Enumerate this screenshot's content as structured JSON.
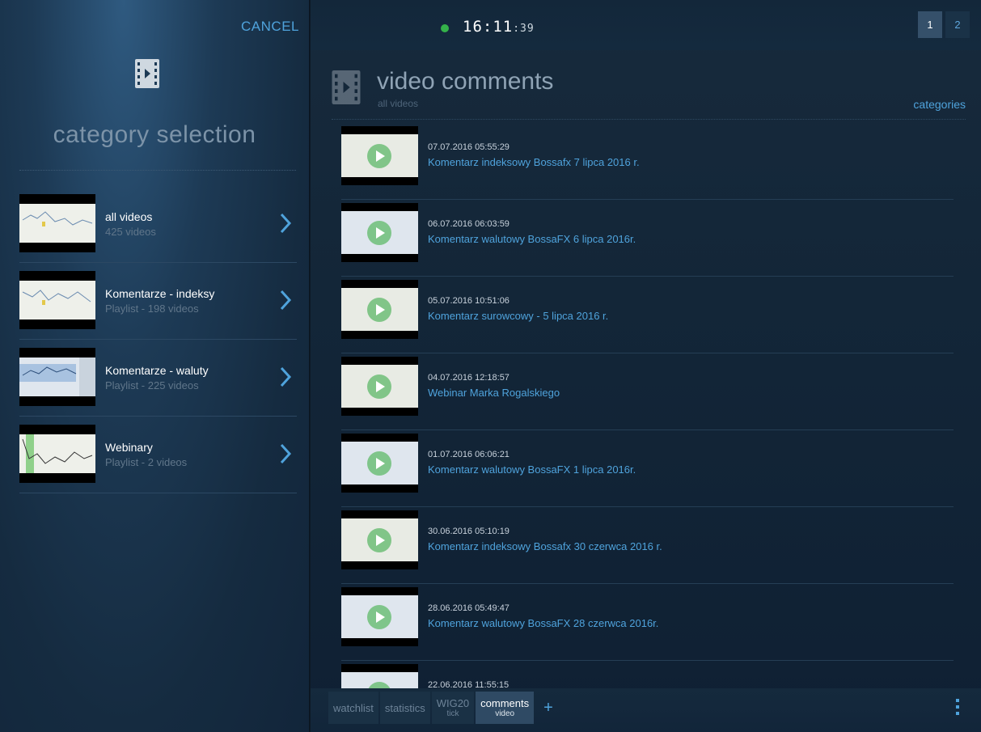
{
  "left_panel": {
    "cancel_label": "CANCEL",
    "title": "category selection",
    "categories": [
      {
        "name": "all videos",
        "sub": "425 videos"
      },
      {
        "name": "Komentarze - indeksy",
        "sub": "Playlist - 198 videos"
      },
      {
        "name": "Komentarze - waluty",
        "sub": "Playlist - 225 videos"
      },
      {
        "name": "Webinary",
        "sub": "Playlist - 2 videos"
      }
    ]
  },
  "top_bar": {
    "status_color": "#34b24a",
    "clock_hm": "16:11",
    "clock_sec": ":39",
    "pages": [
      "1",
      "2"
    ],
    "active_page": "1"
  },
  "main": {
    "title": "video comments",
    "subtitle": "all videos",
    "categories_link": "categories",
    "videos": [
      {
        "date": "07.07.2016 05:55:29",
        "title": "Komentarz indeksowy Bossafx 7 lipca 2016 r."
      },
      {
        "date": "06.07.2016 06:03:59",
        "title": "Komentarz walutowy BossaFX 6 lipca 2016r."
      },
      {
        "date": "05.07.2016 10:51:06",
        "title": "Komentarz surowcowy - 5 lipca 2016 r."
      },
      {
        "date": "04.07.2016 12:18:57",
        "title": "Webinar Marka Rogalskiego"
      },
      {
        "date": "01.07.2016 06:06:21",
        "title": "Komentarz walutowy BossaFX 1 lipca 2016r."
      },
      {
        "date": "30.06.2016 05:10:19",
        "title": "Komentarz indeksowy Bossafx 30 czerwca 2016 r."
      },
      {
        "date": "28.06.2016 05:49:47",
        "title": "Komentarz walutowy BossaFX 28 czerwca 2016r."
      },
      {
        "date": "22.06.2016 11:55:15",
        "title": ""
      }
    ]
  },
  "bottom_tabs": {
    "tabs": [
      {
        "label": "watchlist",
        "sub": ""
      },
      {
        "label": "statistics",
        "sub": ""
      },
      {
        "label": "WIG20",
        "sub": "tick"
      },
      {
        "label": "comments",
        "sub": "video"
      }
    ],
    "add_label": "+",
    "active_index": 3
  },
  "colors": {
    "accent": "#4fa3dc",
    "status_online": "#34b24a"
  }
}
